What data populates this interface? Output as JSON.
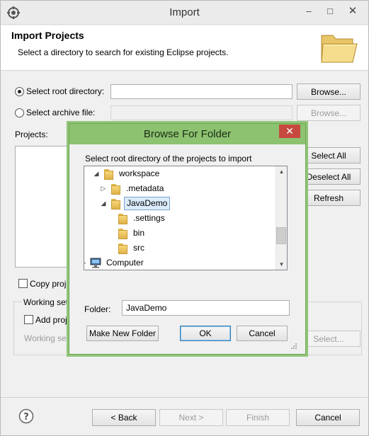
{
  "window": {
    "title": "Import",
    "banner_title": "Import Projects",
    "banner_desc": "Select a directory to search for existing Eclipse projects."
  },
  "import_form": {
    "root_dir_label": "Select root directory:",
    "root_dir_value": "",
    "archive_label": "Select archive file:",
    "archive_value": "",
    "browse_label": "Browse...",
    "browse2_label": "Browse...",
    "projects_label": "Projects:",
    "select_all": "Select All",
    "deselect_all": "Deselect All",
    "refresh": "Refresh",
    "copy_projects": "Copy proje",
    "working_sets_label": "Working sets",
    "add_projects": "Add proje",
    "working_sets_field": "Working set",
    "select_btn": "Select..."
  },
  "footer": {
    "back": "< Back",
    "next": "Next >",
    "finish": "Finish",
    "cancel": "Cancel"
  },
  "dialog": {
    "title": "Browse For Folder",
    "instruction": "Select root directory of the projects to import",
    "folder_label": "Folder:",
    "folder_value": "JavaDemo",
    "make_new_folder": "Make New Folder",
    "ok": "OK",
    "cancel": "Cancel",
    "tree": [
      {
        "label": "workspace",
        "depth": 0,
        "expander": "expanded"
      },
      {
        "label": ".metadata",
        "depth": 1,
        "expander": "collapsed"
      },
      {
        "label": "JavaDemo",
        "depth": 1,
        "expander": "expanded",
        "selected": true
      },
      {
        "label": ".settings",
        "depth": 2,
        "expander": "none"
      },
      {
        "label": "bin",
        "depth": 2,
        "expander": "none"
      },
      {
        "label": "src",
        "depth": 2,
        "expander": "none"
      },
      {
        "label": "Computer",
        "depth": -1,
        "expander": "collapsed"
      }
    ]
  },
  "colors": {
    "dialog_frame": "#8cc270",
    "close_red": "#c7483e",
    "selection": "#dcecfc"
  },
  "icons": {
    "app": "eclipse-gear-icon",
    "banner": "open-folder-icon",
    "help": "help-icon",
    "computer": "computer-icon"
  }
}
